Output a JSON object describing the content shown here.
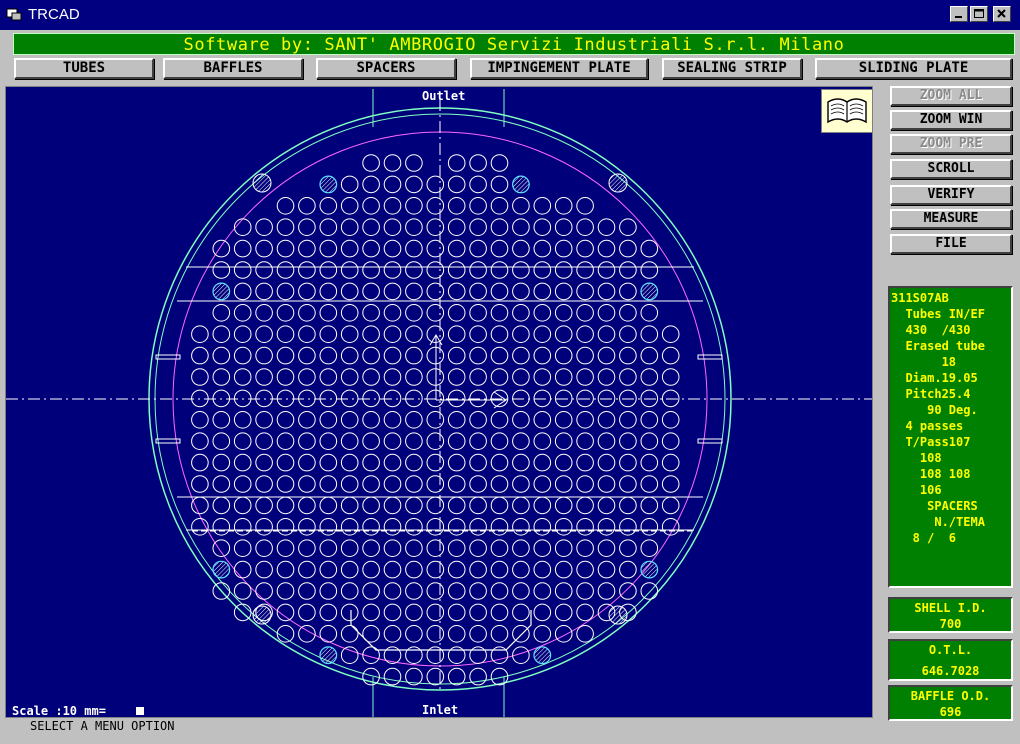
{
  "window": {
    "title": "TRCAD"
  },
  "banner": {
    "text": "Software by: SANT' AMBROGIO Servizi Industriali S.r.l. Milano"
  },
  "toolbar": {
    "buttons": [
      "TUBES",
      "BAFFLES",
      "SPACERS",
      "IMPINGEMENT PLATE",
      "SEALING STRIP",
      "SLIDING PLATE"
    ]
  },
  "canvas": {
    "outlet_label": "Outlet",
    "inlet_label": "Inlet",
    "scale_text": "Scale :10 mm=",
    "colors": {
      "background": "#00007b",
      "tube": "#ffffff",
      "shell": "#80ffc0",
      "baffle": "#ff66ff",
      "erased_tube": "#ff2020",
      "spacer": "#60e0ff"
    },
    "icons": {
      "book": "open-book-icon"
    }
  },
  "sidebar": {
    "buttons": [
      {
        "label": "ZOOM ALL",
        "enabled": false
      },
      {
        "label": "ZOOM WIN",
        "enabled": true
      },
      {
        "label": "ZOOM PRE",
        "enabled": false
      },
      {
        "label": "SCROLL",
        "enabled": true
      },
      {
        "label": "VERIFY",
        "enabled": true
      },
      {
        "label": "MEASURE",
        "enabled": true
      },
      {
        "label": "FILE",
        "enabled": true
      }
    ]
  },
  "info": {
    "lines": [
      "311S07AB",
      "  Tubes IN/EF",
      "  430  /430",
      "  Erased tube",
      "       18",
      "  Diam.19.05",
      "  Pitch25.4",
      "     90 Deg.",
      "  4 passes",
      "  T/Pass107",
      "    108",
      "    108 108",
      "    106",
      "     SPACERS",
      "      N./TEMA",
      "   8 /  6"
    ]
  },
  "shell_id": {
    "label": "SHELL I.D.",
    "value": "700"
  },
  "otl": {
    "label": "O.T.L.",
    "value": "646.7028"
  },
  "baffle_od": {
    "label": "BAFFLE O.D.",
    "value": "696"
  },
  "status": {
    "text": "SELECT A MENU OPTION"
  }
}
